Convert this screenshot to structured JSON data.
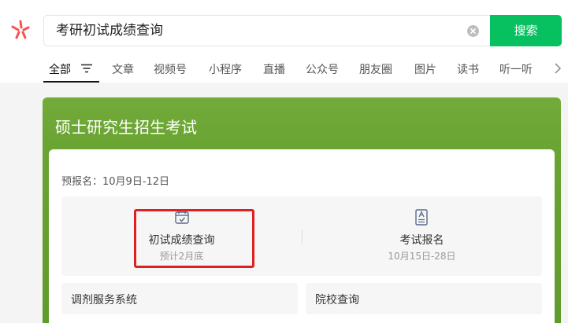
{
  "search": {
    "query": "考研初试成绩查询",
    "button_label": "搜索"
  },
  "tabs": [
    {
      "label": "全部"
    },
    {
      "label": "文章"
    },
    {
      "label": "视频号"
    },
    {
      "label": "小程序"
    },
    {
      "label": "直播"
    },
    {
      "label": "公众号"
    },
    {
      "label": "朋友圈"
    },
    {
      "label": "图片"
    },
    {
      "label": "读书"
    },
    {
      "label": "听一听"
    }
  ],
  "card": {
    "title": "硕士研究生招生考试",
    "prereg": "预报名：10月9日-12日",
    "items": [
      {
        "title": "初试成绩查询",
        "sub": "预计2月底",
        "icon": "calendar-check-icon"
      },
      {
        "title": "考试报名",
        "sub": "10月15日-28日",
        "icon": "document-a-icon"
      }
    ],
    "links": [
      {
        "label": "调剂服务系统"
      },
      {
        "label": "院校查询"
      }
    ]
  },
  "colors": {
    "accent": "#07c160",
    "card_green": "#6aa433",
    "highlight": "#e02020"
  }
}
